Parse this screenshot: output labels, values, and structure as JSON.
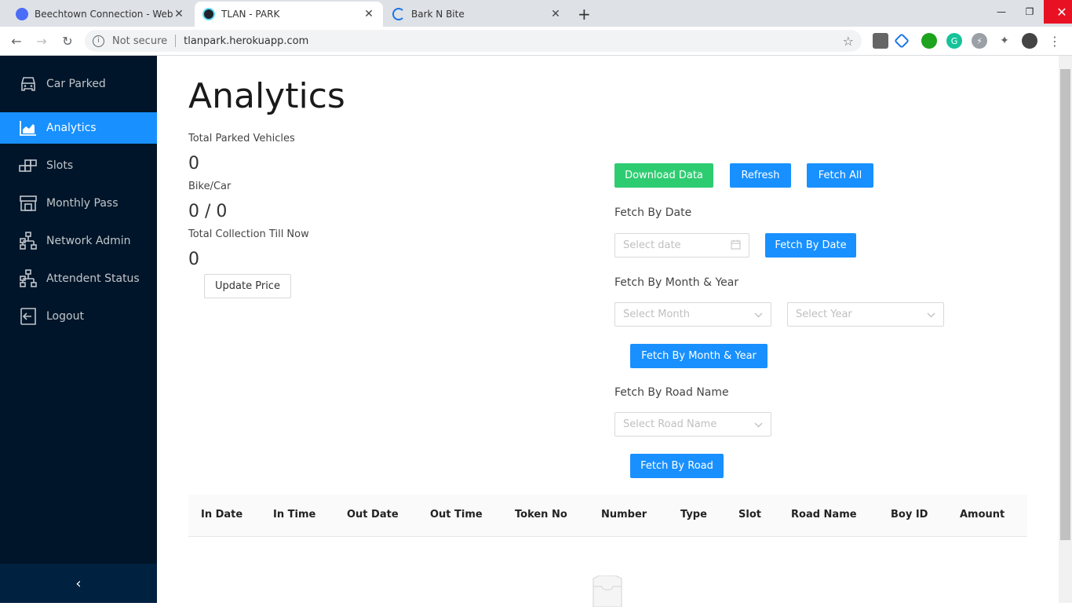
{
  "browser": {
    "tabs": [
      {
        "title": "Beechtown Connection - Website",
        "active": false
      },
      {
        "title": "TLAN - PARK",
        "active": true
      },
      {
        "title": "Bark N Bite",
        "active": false
      }
    ],
    "security_label": "Not secure",
    "url": "tlanpark.herokuapp.com"
  },
  "sidebar": {
    "items": [
      {
        "label": "Car Parked",
        "icon": "car-icon"
      },
      {
        "label": "Analytics",
        "icon": "area-chart-icon"
      },
      {
        "label": "Slots",
        "icon": "slots-icon"
      },
      {
        "label": "Monthly Pass",
        "icon": "shop-icon"
      },
      {
        "label": "Network Admin",
        "icon": "cluster-icon"
      },
      {
        "label": "Attendent Status",
        "icon": "cluster-icon"
      },
      {
        "label": "Logout",
        "icon": "logout-icon"
      }
    ],
    "active": "Analytics",
    "collapse_glyph": "‹"
  },
  "page": {
    "title": "Analytics",
    "stats": {
      "total_parked_label": "Total Parked Vehicles",
      "total_parked_value": "0",
      "bike_car_label": "Bike/Car",
      "bike_car_value": "0 / 0",
      "collection_label": "Total Collection Till Now",
      "collection_value": "0"
    },
    "update_price_label": "Update Price",
    "actions": {
      "download_label": "Download Data",
      "refresh_label": "Refresh",
      "fetch_all_label": "Fetch All"
    },
    "fetch_by_date": {
      "label": "Fetch By Date",
      "placeholder": "Select date",
      "button": "Fetch By Date"
    },
    "fetch_by_month_year": {
      "label": "Fetch By Month & Year",
      "month_placeholder": "Select Month",
      "year_placeholder": "Select Year",
      "button": "Fetch By Month & Year"
    },
    "fetch_by_road": {
      "label": "Fetch By Road Name",
      "placeholder": "Select Road Name",
      "button": "Fetch By Road"
    },
    "table": {
      "columns": [
        "In Date",
        "In Time",
        "Out Date",
        "Out Time",
        "Token No",
        "Number",
        "Type",
        "Slot",
        "Road Name",
        "Boy ID",
        "Amount"
      ],
      "rows": []
    }
  },
  "colors": {
    "sidebar_bg": "#001529",
    "primary": "#1890ff",
    "success": "#2ecc71"
  }
}
